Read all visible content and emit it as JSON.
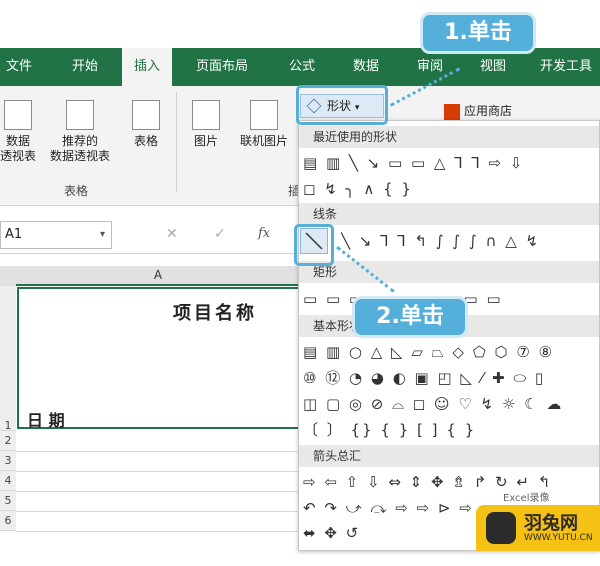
{
  "tabs": [
    "文件",
    "开始",
    "插入",
    "页面布局",
    "公式",
    "数据",
    "审阅",
    "视图",
    "开发工具"
  ],
  "ribbon": {
    "pivot": "数据\n透视表",
    "recommended_pivot": "推荐的\n数据透视表",
    "table": "表格",
    "tables_group": "表格",
    "picture": "图片",
    "online_picture": "联机图片",
    "shapes_button": "形状",
    "store": "应用商店",
    "group_cut": "插"
  },
  "formula": {
    "namebox": "A1",
    "fx": "fx",
    "cancel": "✕",
    "confirm": "✓"
  },
  "sheet": {
    "col_a": "A",
    "title": "项目名称",
    "date": "日 期",
    "rows": [
      "1",
      "2",
      "3",
      "4",
      "5",
      "6"
    ]
  },
  "shapes_menu": {
    "recent": "最近使用的形状",
    "lines": "线条",
    "rect": "矩形",
    "basic": "基本形状",
    "arrows": "箭头总汇",
    "recent_row1": "▤ ▥ ╲ ↘ ▭ ▭ △ ⅂ ⅂ ⇨ ⇩",
    "recent_row2": "◻ ↯ ╮ ∧ { }",
    "lines_row": "╲ ↘ ⅂ ⅂ ↰ ∫ ∫ ∫ ∩ △ ↯",
    "rect_row": "▭ ▭ ▭ ▭ ▭ ▭ ▭ ▭ ▭",
    "basic_row1": "▤ ▥ ○ △ ◺ ▱ ⏢ ◇ ⬠ ⬡ ⑦ ⑧",
    "basic_row2": "⑩ ⑫ ◔ ◕ ◐ ▣ ◰ ◺ ⁄ ✚ ⬭ ▯",
    "basic_row3": "◫ ▢ ◎ ⊘ ⌓ ◻ ☺ ♡ ↯ ☼ ☾ ☁",
    "basic_row4": "〔 〕 {} { } [ ] { }",
    "arrows_row1": "⇨ ⇦ ⇧ ⇩ ⇔ ⇕ ✥ ⇯ ↱ ↻ ↵ ↰",
    "arrows_row2": "↶ ↷ ⤻ ⤼ ⇨ ⇨ ⊳ ⇨ ▭ ⇩",
    "arrows_row3": "⬌ ✥ ↺"
  },
  "callouts": {
    "step1": "1.单击",
    "step2": "2.单击"
  },
  "watermark": {
    "brand": "羽兔网",
    "url": "WWW.YUTU.CN",
    "excel_brand": "Excel录像"
  },
  "colors": {
    "excel_green": "#217346",
    "callout_blue": "#54b0da"
  }
}
